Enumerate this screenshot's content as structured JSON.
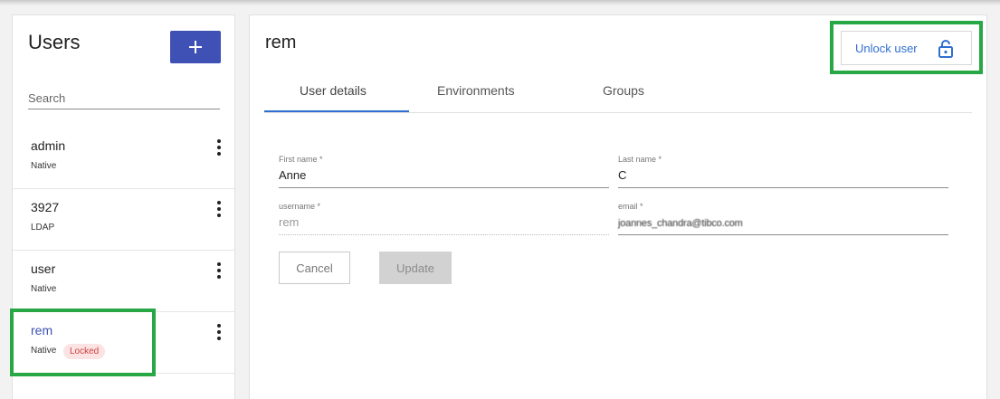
{
  "sidebar": {
    "title": "Users",
    "add_icon": "plus-icon",
    "search_placeholder": "Search",
    "users": [
      {
        "name": "admin",
        "type": "Native",
        "locked": false
      },
      {
        "name": "3927",
        "type": "LDAP",
        "locked": false
      },
      {
        "name": "user",
        "type": "Native",
        "locked": false
      },
      {
        "name": "rem",
        "type": "Native",
        "locked": true,
        "badge": "Locked"
      }
    ]
  },
  "detail": {
    "title": "rem",
    "unlock_label": "Unlock user",
    "unlock_icon": "unlocked-padlock-icon",
    "tabs": [
      "User details",
      "Environments",
      "Groups"
    ],
    "active_tab": "User details",
    "fields": {
      "first_name": {
        "label": "First name *",
        "value": "Anne"
      },
      "last_name": {
        "label": "Last name *",
        "value": "C"
      },
      "username": {
        "label": "username *",
        "value": "rem"
      },
      "email": {
        "label": "email *",
        "value": "joannes_chandra@tibco.com"
      }
    },
    "cancel_label": "Cancel",
    "update_label": "Update"
  },
  "colors": {
    "primary": "#3f51b5",
    "link": "#2f6fd1",
    "highlight": "#28a745",
    "locked_bg": "#fbe3e3",
    "locked_text": "#d04040"
  }
}
